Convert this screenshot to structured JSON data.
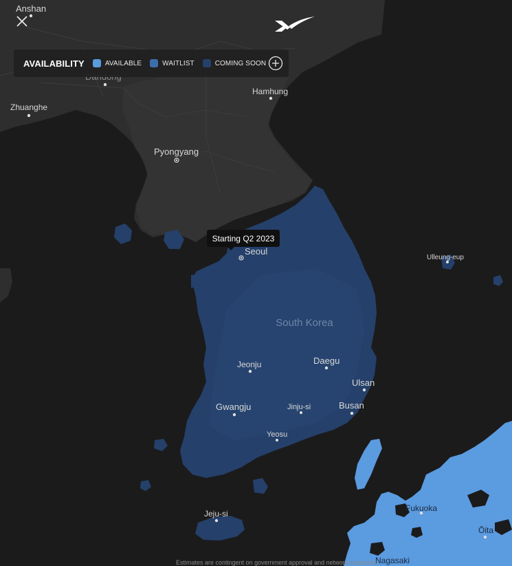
{
  "header": {
    "close_icon": "close-icon",
    "logo_icon": "spacex-logo"
  },
  "legend": {
    "title": "AVAILABILITY",
    "items": [
      {
        "label": "AVAILABLE",
        "color": "#5b9be0"
      },
      {
        "label": "WAITLIST",
        "color": "#3d6eac"
      },
      {
        "label": "COMING SOON",
        "color": "#25406a"
      }
    ],
    "expand_icon": "plus-circle-icon"
  },
  "tooltip": {
    "text": "Starting Q2 2023"
  },
  "map": {
    "country_label": "South Korea",
    "cities": [
      {
        "name": "Anshan"
      },
      {
        "name": "Dandong"
      },
      {
        "name": "Zhuanghe"
      },
      {
        "name": "Hamhung"
      },
      {
        "name": "Pyongyang"
      },
      {
        "name": "Seoul"
      },
      {
        "name": "Ulleung-eup"
      },
      {
        "name": "Jeonju"
      },
      {
        "name": "Daegu"
      },
      {
        "name": "Ulsan"
      },
      {
        "name": "Gwangju"
      },
      {
        "name": "Jinju-si"
      },
      {
        "name": "Busan"
      },
      {
        "name": "Yeosu"
      },
      {
        "name": "Jeju-si"
      },
      {
        "name": "Fukuoka"
      },
      {
        "name": "Ōita"
      },
      {
        "name": "Nagasaki"
      }
    ]
  },
  "footer": {
    "note": "Estimates are contingent on government approval and network expansion"
  }
}
